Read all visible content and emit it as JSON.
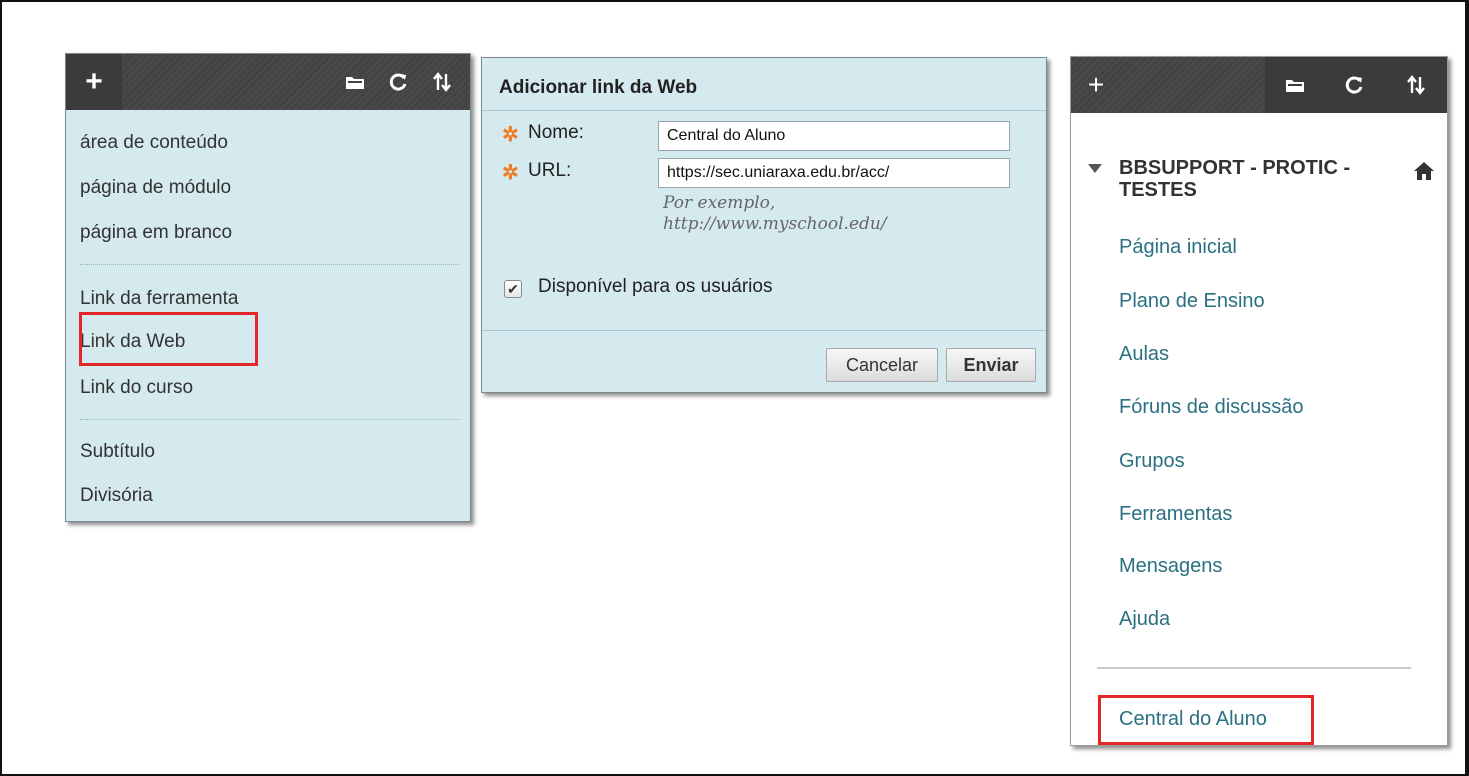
{
  "colors": {
    "panel_bg": "#d5eaef",
    "toolbar_bg": "#4a4a4a",
    "highlight": "#e2262a",
    "required": "#f07c24",
    "link": "#2b7082"
  },
  "menu_panel": {
    "toolbar": {
      "add_label": "+",
      "icons": [
        "folder-icon",
        "refresh-icon",
        "sort-icon"
      ]
    },
    "items_group1": [
      "área de conteúdo",
      "página de módulo",
      "página em branco"
    ],
    "items_group2": [
      "Link da ferramenta",
      "Link da Web",
      "Link do curso"
    ],
    "items_group3": [
      "Subtítulo",
      "Divisória"
    ],
    "highlighted_item": "Link da Web"
  },
  "dialog": {
    "title": "Adicionar link da Web",
    "required_mark": "✲",
    "name_label": "Nome:",
    "name_value": "Central do Aluno",
    "url_label": "URL:",
    "url_value": "https://sec.uniaraxa.edu.br/acc/",
    "example_line1": "Por exemplo,",
    "example_line2": "http://www.myschool.edu/",
    "available_label": "Disponível para os usuários",
    "available_checked": true,
    "cancel_label": "Cancelar",
    "submit_label": "Enviar"
  },
  "course_panel": {
    "toolbar": {
      "add_label": "+",
      "icons": [
        "folder-icon",
        "refresh-icon",
        "sort-icon"
      ]
    },
    "course_title": "BBSUPPORT - PROTIC - TESTES",
    "links": [
      "Página inicial",
      "Plano de Ensino",
      "Aulas",
      "Fóruns de discussão",
      "Grupos",
      "Ferramentas",
      "Mensagens",
      "Ajuda"
    ],
    "new_link": "Central do Aluno"
  }
}
